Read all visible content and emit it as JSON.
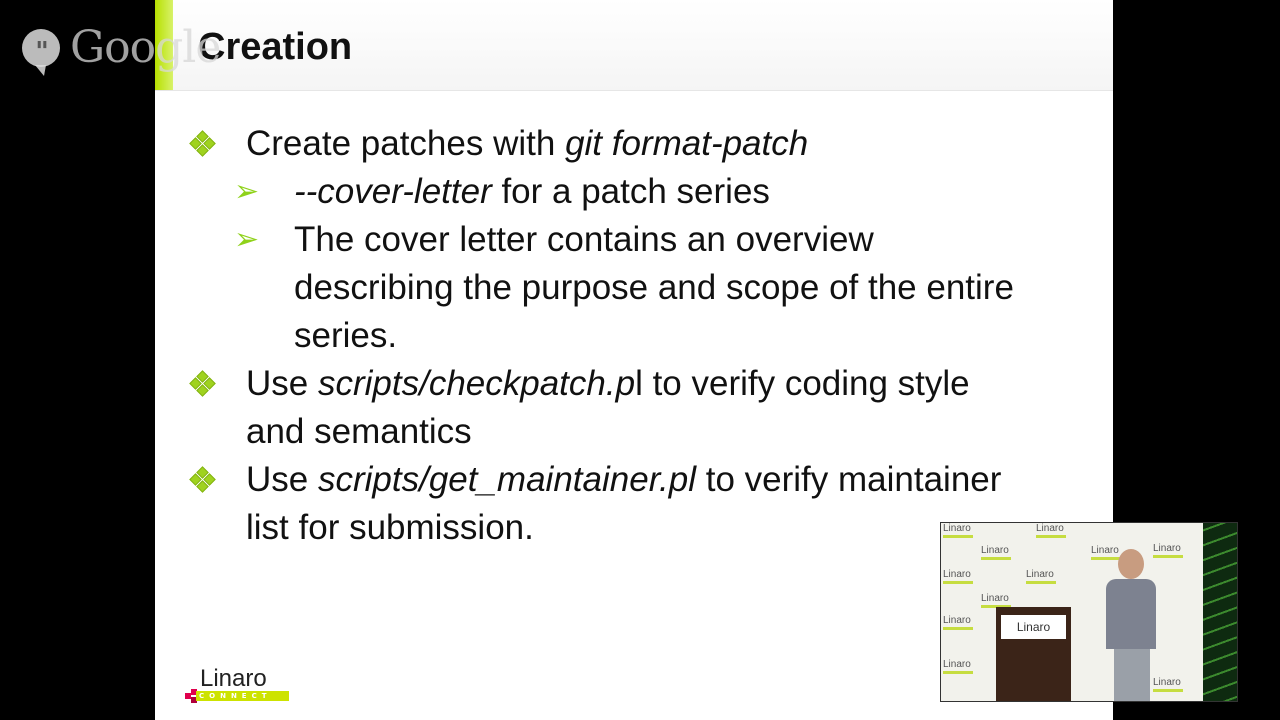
{
  "overlay": {
    "hangouts_brand": "Google"
  },
  "slide": {
    "title": "Creation",
    "bullets": [
      {
        "level": 1,
        "prefix": "Create patches with ",
        "code": "git format-patch",
        "suffix": "",
        "line2": ""
      },
      {
        "level": 2,
        "prefix": "",
        "code": "--cover-letter",
        "suffix": " for a patch series"
      },
      {
        "level": 2,
        "text_lines": [
          "The cover letter contains an overview",
          "describing the purpose and scope of the entire",
          "series."
        ]
      },
      {
        "level": 1,
        "prefix": "Use ",
        "code": "scripts/checkpatch.p",
        "suffix": "l to verify coding style",
        "line2": "and semantics"
      },
      {
        "level": 1,
        "prefix": "Use ",
        "code": "scripts/get_maintainer.pl",
        "suffix": " to verify maintainer",
        "line2": "list for submission."
      }
    ],
    "logo": {
      "word": "Linaro",
      "tagline": "CONNECT"
    }
  },
  "webcam": {
    "backdrop_text": "Linaro",
    "podium_sign": "Linaro"
  },
  "colors": {
    "accent": "#b7e000",
    "bullet": "#9fd21e",
    "arrow": "#8fd21a"
  },
  "icons": {
    "level1": "diamond-bullet-icon",
    "level2": "arrow-bullet-icon"
  }
}
